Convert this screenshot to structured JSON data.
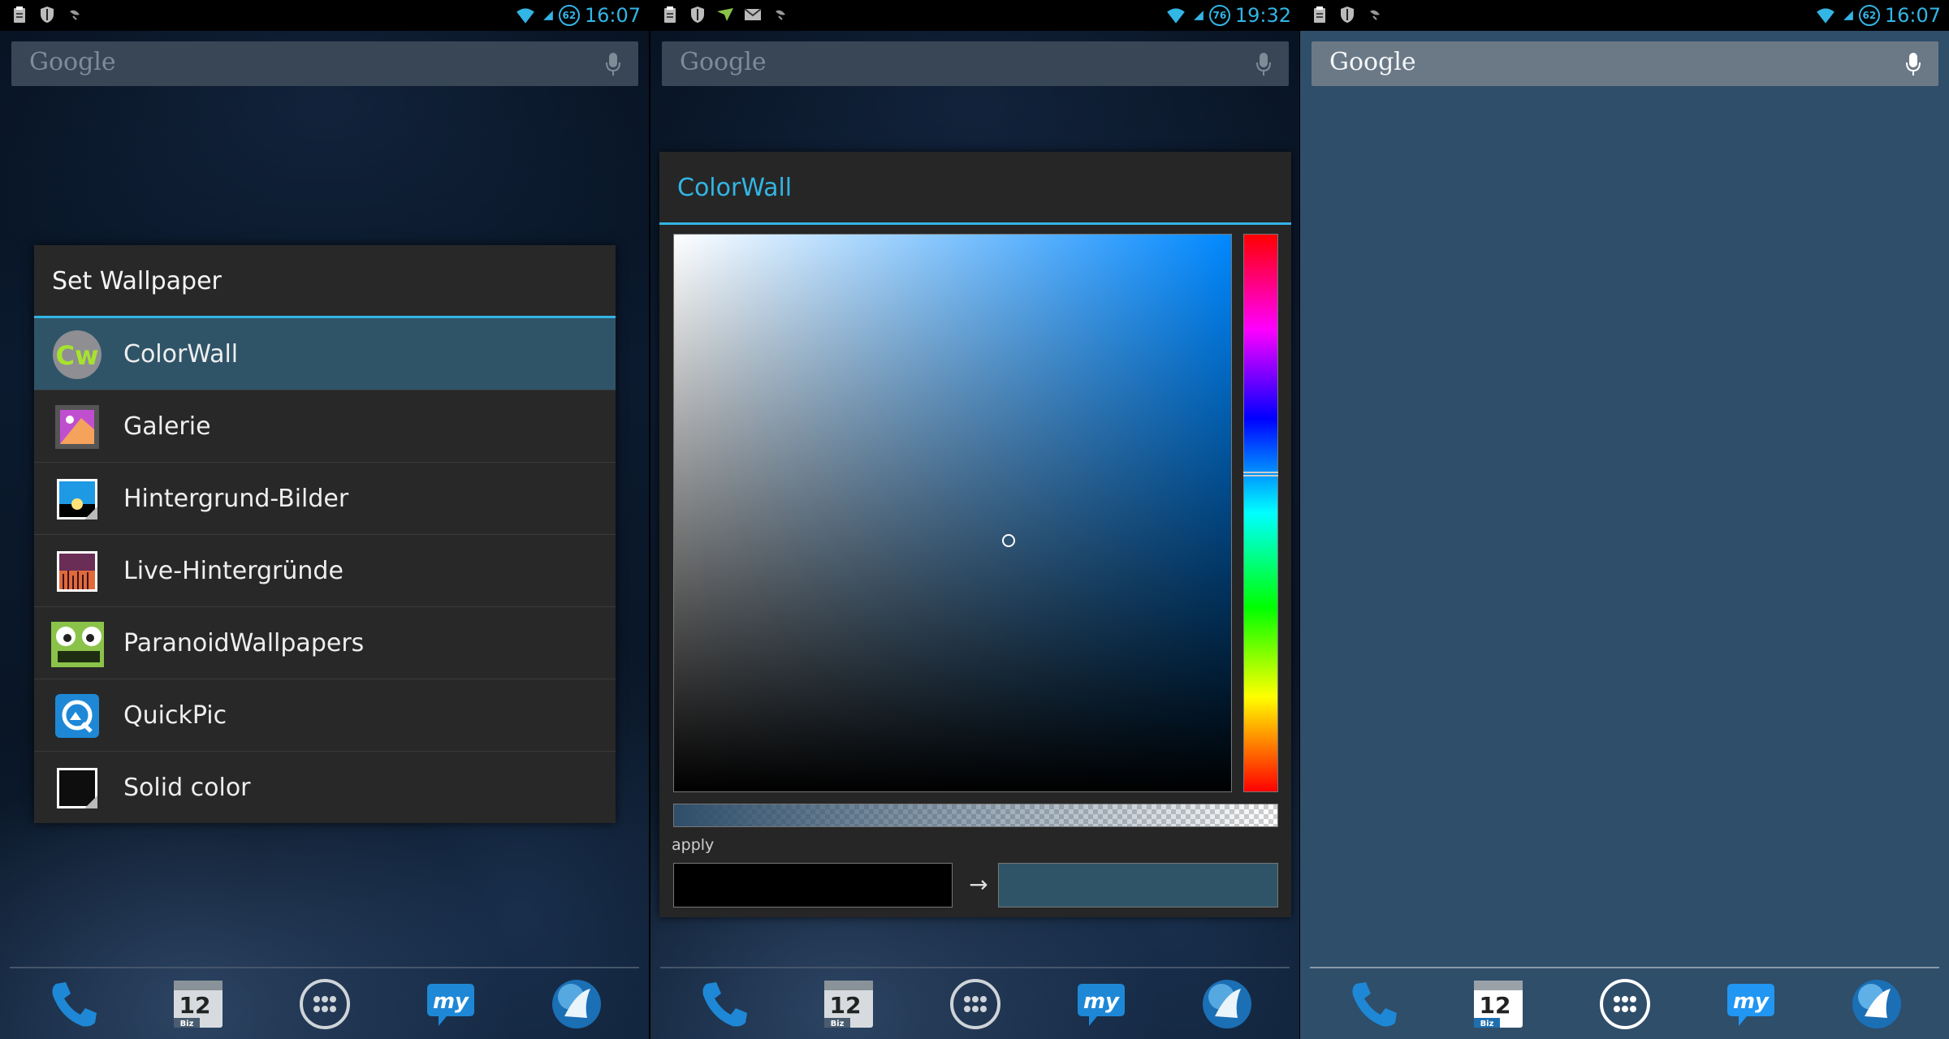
{
  "colors": {
    "accent": "#33b5e5",
    "wallpaper_selected": "#2f4e6a",
    "dialog_bg": "#282828",
    "selected_row": "#2f5468",
    "old_color": "#000000",
    "new_color": "#2f5468"
  },
  "panels": [
    {
      "status": {
        "clock": "16:07",
        "battery": "62",
        "left_icons": [
          "clipboard-icon",
          "shield-icon",
          "satellite-icon"
        ]
      },
      "search": {
        "label": "Google"
      },
      "dialog": {
        "title": "Set Wallpaper",
        "items": [
          {
            "label": "ColorWall",
            "icon": "colorwall-icon",
            "selected": true
          },
          {
            "label": "Galerie",
            "icon": "gallery-icon"
          },
          {
            "label": "Hintergrund-Bilder",
            "icon": "wallpapers-icon"
          },
          {
            "label": "Live-Hintergründe",
            "icon": "live-wallpapers-icon"
          },
          {
            "label": "ParanoidWallpapers",
            "icon": "paranoid-icon"
          },
          {
            "label": "QuickPic",
            "icon": "quickpic-icon"
          },
          {
            "label": "Solid color",
            "icon": "solid-color-icon"
          }
        ]
      }
    },
    {
      "status": {
        "clock": "19:32",
        "battery": "76",
        "left_icons": [
          "clipboard-icon",
          "shield-icon",
          "arrow-icon",
          "mail-icon",
          "satellite-icon"
        ]
      },
      "search": {
        "label": "Google"
      },
      "colorwall": {
        "title": "ColorWall",
        "apply_label": "apply",
        "arrow": "→",
        "hue_position": 0.43,
        "saturation": 0.6,
        "value": 0.45
      }
    },
    {
      "status": {
        "clock": "16:07",
        "battery": "62",
        "left_icons": [
          "clipboard-icon",
          "shield-icon",
          "satellite-icon"
        ]
      },
      "search": {
        "label": "Google"
      }
    }
  ],
  "dock": {
    "items": [
      {
        "name": "phone-icon"
      },
      {
        "name": "calendar-icon",
        "day": "12",
        "sub": "Biz"
      },
      {
        "name": "app-drawer-icon"
      },
      {
        "name": "my-app-icon",
        "text": "my"
      },
      {
        "name": "browser-icon"
      }
    ]
  }
}
